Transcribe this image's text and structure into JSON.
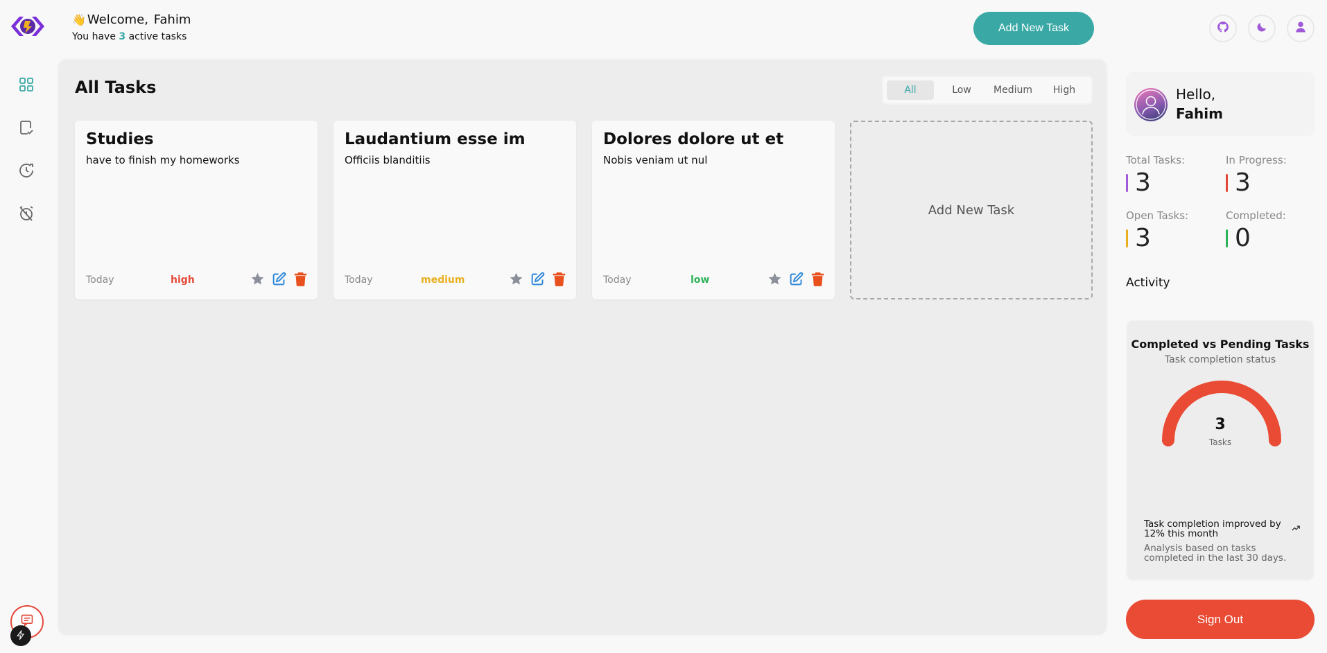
{
  "header": {
    "wave": "👋",
    "welcome_prefix": "Welcome, ",
    "user_name": "Fahim",
    "active_prefix": "You have ",
    "active_count": "3",
    "active_suffix": " active tasks",
    "add_task_label": "Add New Task"
  },
  "main": {
    "title": "All Tasks",
    "filters": [
      "All",
      "Low",
      "Medium",
      "High"
    ],
    "active_filter": "All",
    "tasks": [
      {
        "title": "Studies",
        "description": "have to finish my homeworks",
        "date": "Today",
        "priority": "high",
        "priority_color": "#e24a3a"
      },
      {
        "title": "Laudantium esse im",
        "description": "Officiis blanditiis",
        "date": "Today",
        "priority": "medium",
        "priority_color": "#e8b020"
      },
      {
        "title": "Dolores dolore ut et",
        "description": "Nobis veniam ut nul",
        "date": "Today",
        "priority": "low",
        "priority_color": "#2fb35a"
      }
    ],
    "add_card_label": "Add New Task"
  },
  "profile": {
    "hello": "Hello,",
    "name": "Fahim"
  },
  "stats": [
    {
      "label": "Total Tasks:",
      "value": "3",
      "color": "#a05ad8"
    },
    {
      "label": "In Progress:",
      "value": "3",
      "color": "#e24a3a"
    },
    {
      "label": "Open Tasks:",
      "value": "3",
      "color": "#e8b020"
    },
    {
      "label": "Completed:",
      "value": "0",
      "color": "#2fb35a"
    }
  ],
  "activity": {
    "heading": "Activity",
    "chart_title": "Completed vs Pending Tasks",
    "chart_subtitle": "Task completion status",
    "gauge_value": "3",
    "gauge_label": "Tasks",
    "gauge_color": "#e94b35",
    "trend_text": "Task completion improved by 12% this month",
    "note": "Analysis based on tasks completed in the last 30 days."
  },
  "signout_label": "Sign Out",
  "colors": {
    "accent": "#3aa9a6",
    "danger": "#e94b35",
    "brand": "#7b2fd8"
  }
}
